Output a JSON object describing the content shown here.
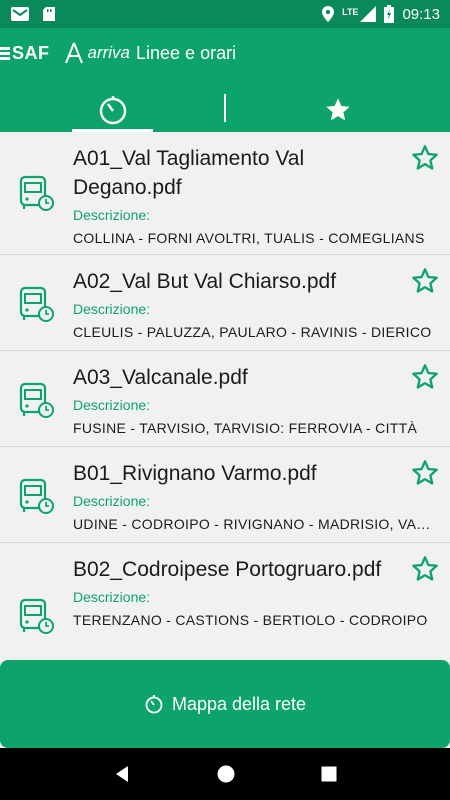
{
  "status_bar": {
    "time": "09:13",
    "network": "LTE",
    "icons": [
      "gmail-icon",
      "sd-card-icon",
      "location-icon",
      "signal-icon",
      "battery-charging-icon"
    ]
  },
  "app_bar": {
    "brand_saf": "SAF",
    "brand_arriva": "arriva",
    "title": "Linee e orari"
  },
  "tabs": [
    {
      "icon": "timer-icon",
      "selected": true
    },
    {
      "icon": "star-icon",
      "selected": false
    }
  ],
  "lines": [
    {
      "title": "A01_Val Tagliamento Val Degano.pdf",
      "desc_label": "Descrizione:",
      "desc": "COLLINA - FORNI AVOLTRI, TUALIS - COMEGLIANS"
    },
    {
      "title": "A02_Val But Val Chiarso.pdf",
      "desc_label": "Descrizione:",
      "desc": "CLEULIS - PALUZZA, PAULARO - RAVINIS - DIERICO"
    },
    {
      "title": "A03_Valcanale.pdf",
      "desc_label": "Descrizione:",
      "desc": "FUSINE - TARVISIO, TARVISIO: FERROVIA - CITTÀ"
    },
    {
      "title": "B01_Rivignano Varmo.pdf",
      "desc_label": "Descrizione:",
      "desc": "UDINE - CODROIPO - RIVIGNANO - MADRISIO, VARMO"
    },
    {
      "title": "B02_Codroipese Portogruaro.pdf",
      "desc_label": "Descrizione:",
      "desc": "TERENZANO - CASTIONS - BERTIOLO - CODROIPO"
    }
  ],
  "map_button": {
    "label": "Mappa della rete"
  },
  "colors": {
    "primary": "#0da46b",
    "status": "#0a8a5b",
    "background": "#f1f1f1"
  }
}
